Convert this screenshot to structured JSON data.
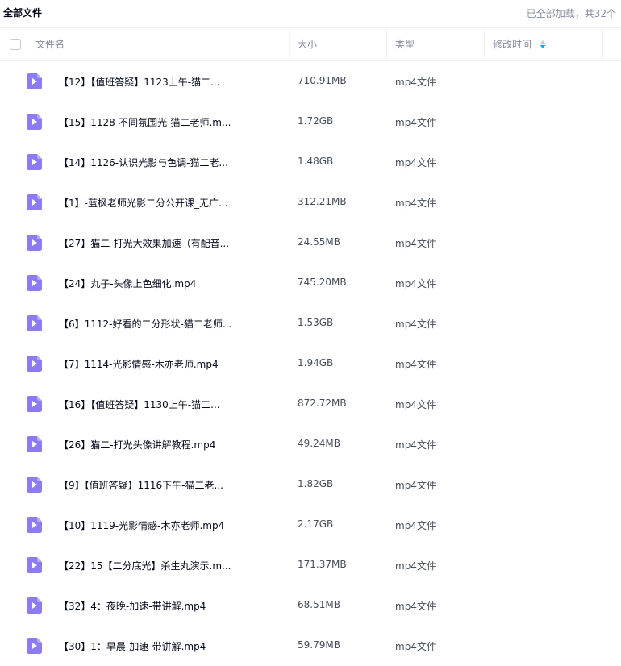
{
  "topbar": {
    "crumb": "全部文件",
    "load_status": "已全部加载，共32个"
  },
  "columns": {
    "name": "文件名",
    "size": "大小",
    "type": "类型",
    "modified": "修改时间"
  },
  "colors": {
    "icon": "#8c7cf4",
    "sort": "#06a7ff"
  },
  "files": [
    {
      "name": "【12】【值班答疑】1123上午-猫二...",
      "size": "710.91MB",
      "type": "mp4文件"
    },
    {
      "name": "【15】1128-不同氛围光-猫二老师.m...",
      "size": "1.72GB",
      "type": "mp4文件"
    },
    {
      "name": "【14】1126-认识光影与色调-猫二老...",
      "size": "1.48GB",
      "type": "mp4文件"
    },
    {
      "name": "【1】-蓝枫老师光影二分公开课_无广...",
      "size": "312.21MB",
      "type": "mp4文件"
    },
    {
      "name": "【27】猫二-打光大效果加速（有配音...",
      "size": "24.55MB",
      "type": "mp4文件"
    },
    {
      "name": "【24】丸子-头像上色细化.mp4",
      "size": "745.20MB",
      "type": "mp4文件"
    },
    {
      "name": "【6】1112-好看的二分形状-猫二老师...",
      "size": "1.53GB",
      "type": "mp4文件"
    },
    {
      "name": "【7】1114-光影情感-木亦老师.mp4",
      "size": "1.94GB",
      "type": "mp4文件"
    },
    {
      "name": "【16】【值班答疑】1130上午-猫二...",
      "size": "872.72MB",
      "type": "mp4文件"
    },
    {
      "name": "【26】猫二-打光头像讲解教程.mp4",
      "size": "49.24MB",
      "type": "mp4文件"
    },
    {
      "name": "【9】【值班答疑】1116下午-猫二老...",
      "size": "1.82GB",
      "type": "mp4文件"
    },
    {
      "name": "【10】1119-光影情感-木亦老师.mp4",
      "size": "2.17GB",
      "type": "mp4文件"
    },
    {
      "name": "【22】15【二分底光】杀生丸演示.m...",
      "size": "171.37MB",
      "type": "mp4文件"
    },
    {
      "name": "【32】4：夜晚-加速-带讲解.mp4",
      "size": "68.51MB",
      "type": "mp4文件"
    },
    {
      "name": "【30】1：早晨-加速-带讲解.mp4",
      "size": "59.79MB",
      "type": "mp4文件"
    }
  ]
}
